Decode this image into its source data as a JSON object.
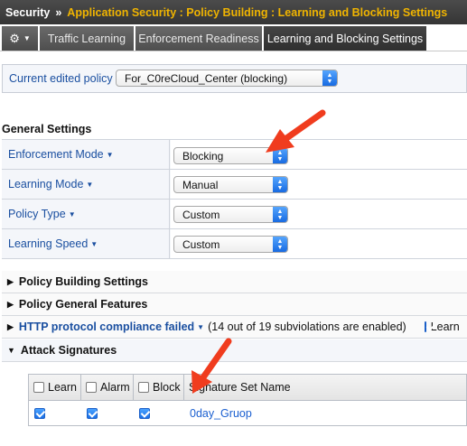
{
  "breadcrumb": {
    "root": "Security",
    "separator": "»",
    "path": "Application Security : Policy Building : Learning and Blocking Settings"
  },
  "tabs": [
    {
      "label": "Traffic Learning",
      "active": false
    },
    {
      "label": "Enforcement Readiness",
      "active": false
    },
    {
      "label": "Learning and Blocking Settings",
      "active": true
    }
  ],
  "policy": {
    "label": "Current edited policy",
    "value": "For_C0reCloud_Center (blocking)"
  },
  "general_settings": {
    "title": "General Settings",
    "rows": [
      {
        "label": "Enforcement Mode",
        "value": "Blocking"
      },
      {
        "label": "Learning Mode",
        "value": "Manual"
      },
      {
        "label": "Policy Type",
        "value": "Custom"
      },
      {
        "label": "Learning Speed",
        "value": "Custom"
      }
    ]
  },
  "sections": {
    "policy_building": "Policy Building Settings",
    "policy_general": "Policy General Features",
    "http_compliance": "HTTP protocol compliance failed",
    "http_compliance_note": "(14 out of 19 subviolations are enabled)",
    "http_learn_label": "Learn",
    "attack_signatures": "Attack Signatures"
  },
  "signature_table": {
    "columns": [
      "Learn",
      "Alarm",
      "Block",
      "Signature Set Name"
    ],
    "rows": [
      {
        "learn": true,
        "alarm": true,
        "block": true,
        "name": "0day_Gruop"
      }
    ]
  },
  "colors": {
    "accent_blue": "#1a4fa0",
    "breadcrumb_yellow": "#f0b400",
    "annotation_arrow": "#f03c1e"
  },
  "icons": {
    "settings_menu": "gear-icon",
    "annotation": "red-arrow"
  }
}
